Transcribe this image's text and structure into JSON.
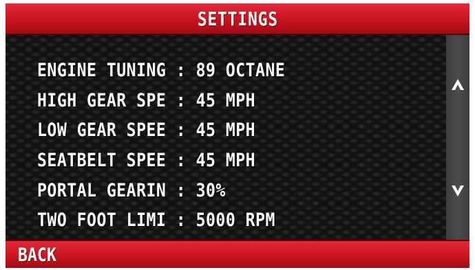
{
  "header": {
    "title": "SETTINGS"
  },
  "settings": [
    {
      "label": "ENGINE TUNING",
      "value": "89 OCTANE"
    },
    {
      "label": "HIGH GEAR SPE",
      "value": "45 MPH"
    },
    {
      "label": "LOW GEAR SPEE",
      "value": "45 MPH"
    },
    {
      "label": "SEATBELT SPEE",
      "value": "45 MPH"
    },
    {
      "label": "PORTAL GEARIN",
      "value": "30%"
    },
    {
      "label": "TWO FOOT LIMI",
      "value": "5000 RPM"
    }
  ],
  "separator": ":",
  "scrollbar": {
    "up_icon": "arrow-up-icon",
    "down_icon": "arrow-down-icon"
  },
  "footer": {
    "back_label": "BACK"
  },
  "colors": {
    "accent_red": "#c7131f",
    "text": "#ffffff",
    "background": "#121212",
    "scrollbar": "#444444"
  }
}
